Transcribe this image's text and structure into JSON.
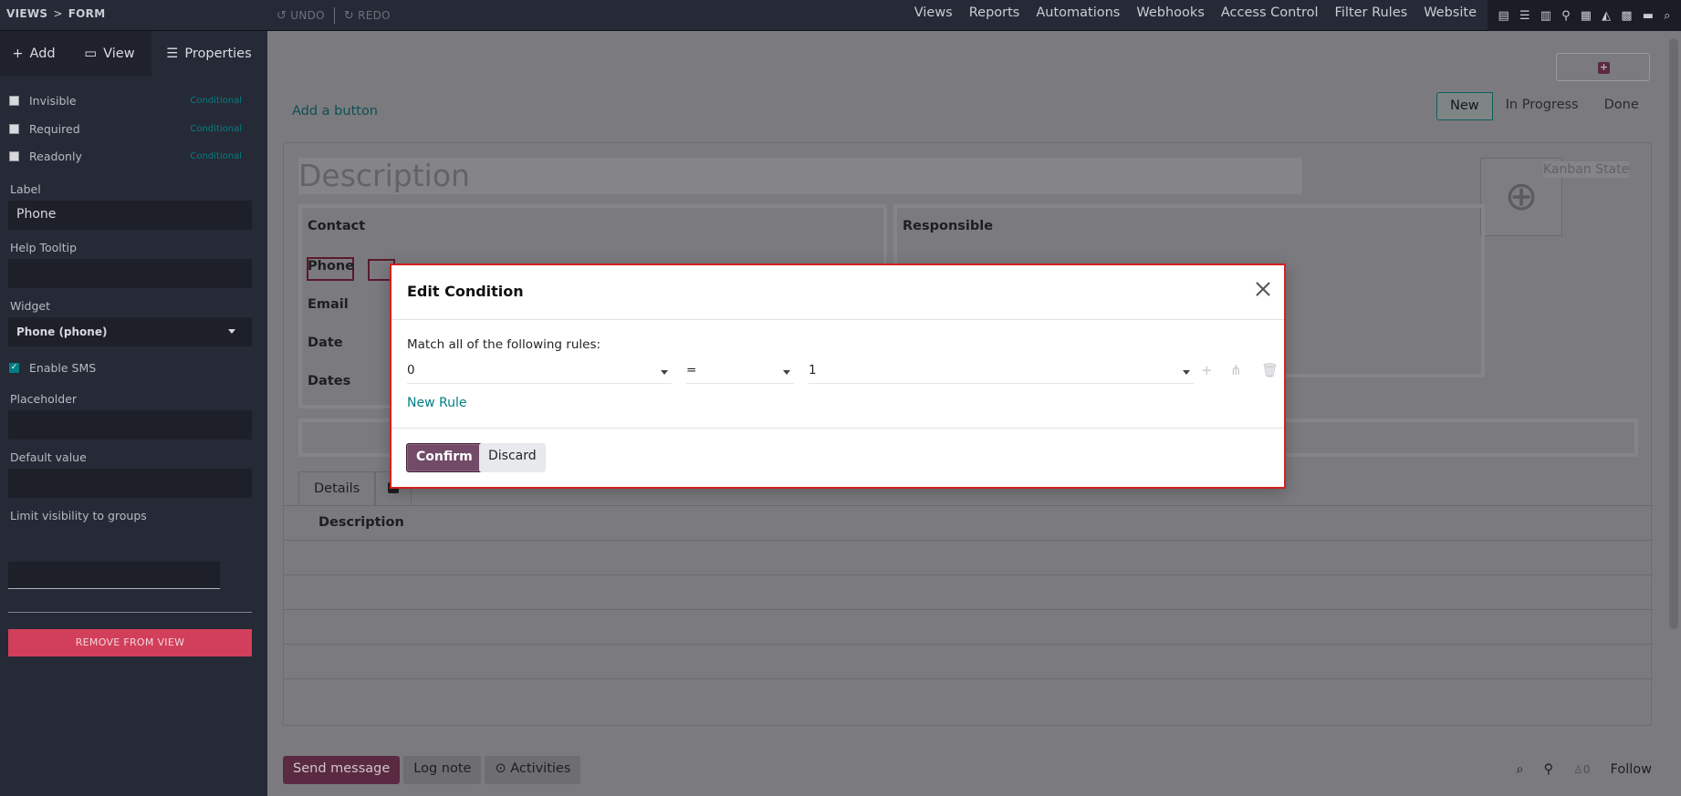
{
  "breadcrumb": {
    "first": "VIEWS",
    "separator": ">",
    "current": "FORM"
  },
  "history": {
    "undo": "UNDO",
    "redo": "REDO"
  },
  "top_menu": [
    "Views",
    "Reports",
    "Automations",
    "Webhooks",
    "Access Control",
    "Filter Rules",
    "Website"
  ],
  "view_switcher_icons": [
    "form-view-icon",
    "list-view-icon",
    "kanban-view-icon",
    "map-view-icon",
    "calendar-view-icon",
    "graph-view-icon",
    "pivot-view-icon",
    "gantt-view-icon",
    "search-view-icon"
  ],
  "sidebar": {
    "tabs": [
      {
        "icon": "+",
        "label": "Add"
      },
      {
        "icon": "▭",
        "label": "View"
      },
      {
        "icon": "☰",
        "label": "Properties"
      }
    ],
    "checkboxes": [
      {
        "label": "Invisible",
        "link": "Conditional",
        "checked": false
      },
      {
        "label": "Required",
        "link": "Conditional",
        "checked": false
      },
      {
        "label": "Readonly",
        "link": "Conditional",
        "checked": false
      }
    ],
    "label_caption": "Label",
    "label_value": "Phone",
    "help_caption": "Help Tooltip",
    "widget_caption": "Widget",
    "widget_value": "Phone (phone)",
    "enable_sms": {
      "label": "Enable SMS",
      "checked": true
    },
    "placeholder_caption": "Placeholder",
    "default_caption": "Default value",
    "groups_caption": "Limit visibility to groups",
    "remove_label": "REMOVE FROM VIEW"
  },
  "form": {
    "add_button": "Add a button",
    "stages": [
      "New",
      "In Progress",
      "Done"
    ],
    "title_placeholder": "Description",
    "kanban_state": "Kanban State",
    "left_group": {
      "title": "Contact",
      "fields": [
        "Phone",
        "Email",
        "Date",
        "Dates"
      ]
    },
    "right_group": {
      "title": "Responsible"
    },
    "tabs": [
      "Details"
    ],
    "list_header": "Description"
  },
  "chatter": {
    "send": "Send message",
    "log": "Log note",
    "activities": "Activities",
    "followers": "0",
    "follow": "Follow"
  },
  "dialog": {
    "title": "Edit Condition",
    "rules_label": "Match all of the following rules:",
    "rule": {
      "path": "0",
      "operator": "=",
      "value": "1"
    },
    "new_rule": "New Rule",
    "confirm": "Confirm",
    "discard": "Discard"
  },
  "colors": {
    "primary": "#714b67",
    "accent": "#017e84",
    "danger": "#d23f5a",
    "modal_outline": "#d32020"
  }
}
